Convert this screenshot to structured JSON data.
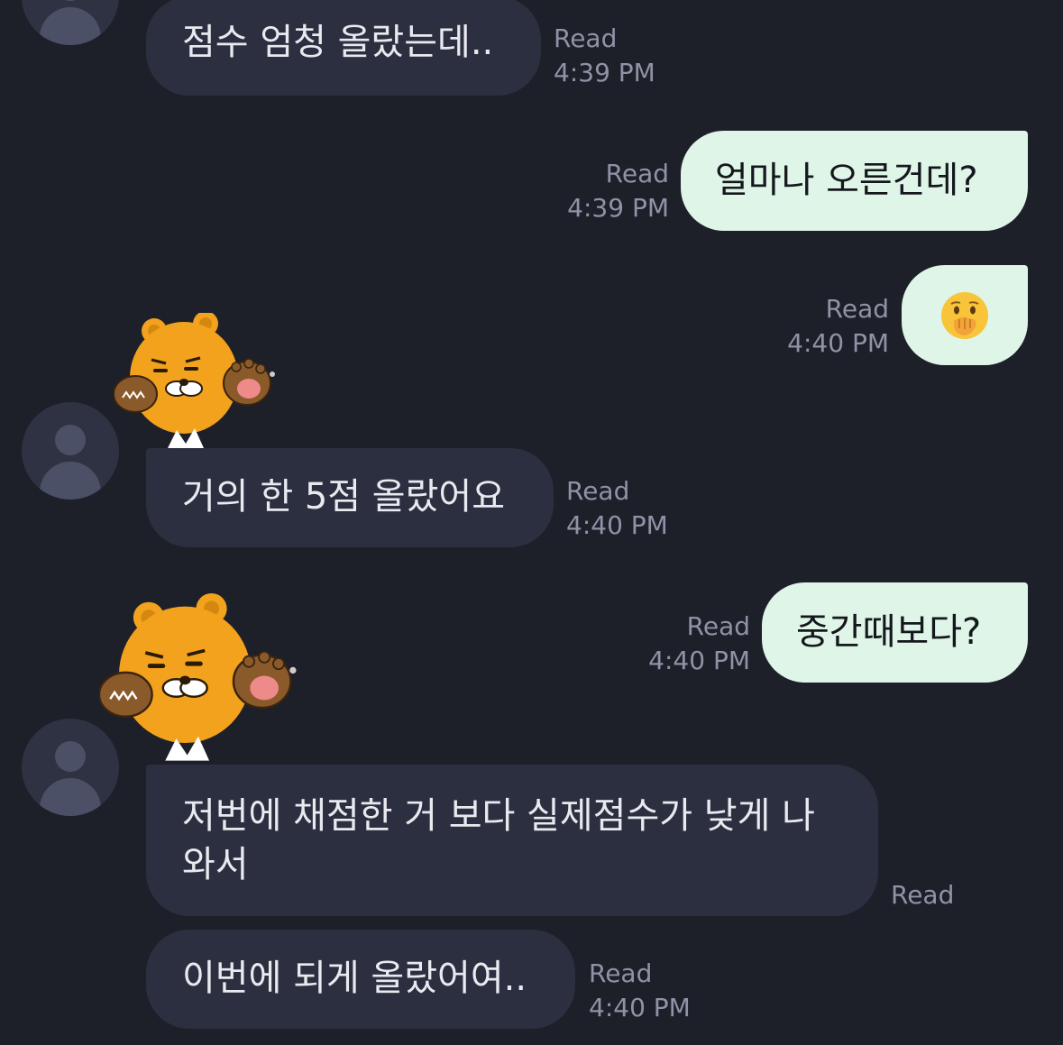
{
  "messages": [
    {
      "side": "in",
      "text": "점수 엄청 올랐는데..",
      "read": "Read",
      "time": "4:39 PM"
    },
    {
      "side": "out",
      "text": "얼마나 오른건데?",
      "read": "Read",
      "time": "4:39 PM"
    },
    {
      "side": "out",
      "text": "🫢",
      "read": "Read",
      "time": "4:40 PM"
    },
    {
      "side": "in",
      "sticker": "ryan-bear-sticker",
      "text": "거의 한 5점 올랐어요",
      "read": "Read",
      "time": "4:40 PM"
    },
    {
      "side": "out",
      "text": "중간때보다?",
      "read": "Read",
      "time": "4:40 PM"
    },
    {
      "side": "in",
      "sticker": "ryan-bear-sticker",
      "text_line1": "저번에 채점한 거 보다 실제점수가 낮게 나",
      "text_line2": "와서",
      "read": "Read"
    },
    {
      "side": "in",
      "text": "이번에 되게 올랐어여..",
      "read": "Read",
      "time": "4:40 PM"
    }
  ],
  "colors": {
    "background": "#1d1f29",
    "incoming_bubble": "#2c2f3f",
    "outgoing_bubble": "#dff5e8",
    "meta_text": "#8e93a6",
    "avatar": "#2f3243"
  },
  "icons": {
    "avatar": "default-profile-icon",
    "sticker": "ryan-bear-sticker"
  }
}
